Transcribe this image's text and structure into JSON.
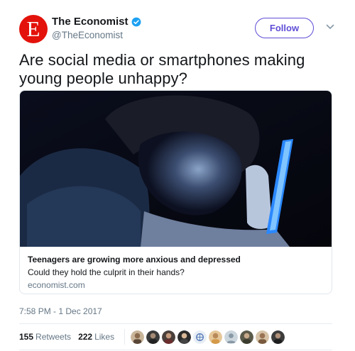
{
  "author": {
    "avatar_letter": "E",
    "display_name": "The Economist",
    "handle": "@TheEconomist",
    "brand_color": "#e3120b",
    "verified": true
  },
  "follow_label": "Follow",
  "tweet_text": "Are social media or smartphones making young people unhappy?",
  "card": {
    "title": "Teenagers are growing more anxious and depressed",
    "description": "Could they hold the culprit in their hands?",
    "domain": "economist.com"
  },
  "timestamp": "7:58 PM - 1 Dec 2017",
  "stats": {
    "retweets_count": "155",
    "retweets_label": "Retweets",
    "likes_count": "222",
    "likes_label": "Likes"
  },
  "colors": {
    "accent": "#5e4dd6",
    "verified": "#1da1f2",
    "muted": "#657786"
  }
}
